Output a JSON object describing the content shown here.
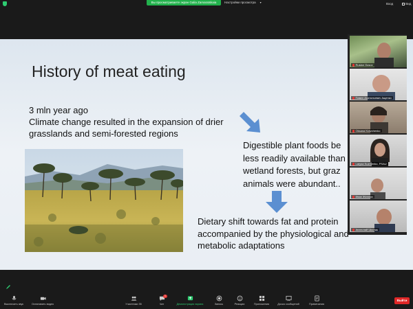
{
  "topbar": {
    "share_notice": "Вы просматриваете экран Galia Zamaratskaia",
    "view_options": "Настройки просмотра",
    "view_chevron": "▾",
    "enter_label": "Вход",
    "exit_label": "Вид"
  },
  "slide": {
    "title": "History of meat eating",
    "p1_line1": "3 mln year ago",
    "p1_line2": "Climate change resulted in the expansion of drier",
    "p1_line3": "grasslands and semi-forested regions",
    "p2_line1": "Digestible plant foods be",
    "p2_line2": "less readily available than",
    "p2_line3": "wetland forests, but graz",
    "p2_line4": "animals were abundant..",
    "p3_line1": "Dietary shift towards fat and protein",
    "p3_line2": "accompanied by the physiological and",
    "p3_line3": "metabolic adaptations",
    "arrow_color": "#5b8fd1"
  },
  "participants": [
    {
      "name": "Ruslan Gusov"
    },
    {
      "name": "Павел Анатольевич Ащенко"
    },
    {
      "name": "Oksana Kravchenko"
    },
    {
      "name": "Larysa Kuzmenko, PSAU"
    },
    {
      "name": "Иван Желнин"
    },
    {
      "name": "Анатолий Шостак"
    }
  ],
  "toolbar": {
    "mute": "Выключить звук",
    "video": "Остановить видео",
    "participants": "Участники",
    "participants_count": "35",
    "chat": "Чат",
    "chat_badge": "1",
    "share": "Демонстрация экрана",
    "record": "Запись",
    "reactions": "Реакции",
    "apps": "Приложения",
    "whiteboard": "Доска сообщений",
    "notes": "Примечания",
    "exit": "Выйти"
  },
  "colors": {
    "accent_green": "#22b14c",
    "exit_red": "#e02828",
    "toolbar_bg": "#1a1a1a"
  }
}
